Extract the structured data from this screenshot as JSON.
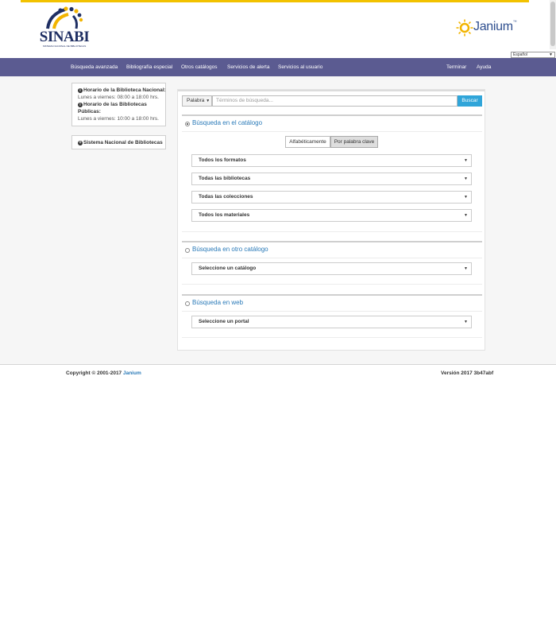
{
  "header": {
    "logo_left": {
      "text": "SINABI",
      "subtitle": "SISTEMA NACIONAL DE BIBLIOTECAS"
    },
    "logo_right": {
      "text": "Janium",
      "tm": "™"
    },
    "language": "Español"
  },
  "nav": {
    "left": [
      "Búsqueda avanzada",
      "Bibliografía especial",
      "Otros catálogos",
      "Servicios de alerta",
      "Servicios al usuario"
    ],
    "right": [
      "Terminar",
      "Ayuda"
    ]
  },
  "sidebar": {
    "hours": {
      "line1": "Horario de la Biblioteca Nacional:",
      "line2": "Lunes a viernes: 08:00 a 18:00 hrs.",
      "line3": "Horario de las Bibliotecas",
      "line4": "Públicas:",
      "line5": "Lunes a viernes: 10:00 a 18:00 hrs."
    },
    "link": "Sistema Nacional de Bibliotecas"
  },
  "search": {
    "type_label": "Palabra",
    "placeholder": "Términos de búsqueda...",
    "button": "Buscar"
  },
  "catalog_section": {
    "title": "Búsqueda en el catálogo",
    "selected": true,
    "toggle": {
      "alpha": "Alfabéticamente",
      "keyword": "Por palabra clave",
      "active": "keyword"
    },
    "filters": [
      "Todos los formatos",
      "Todas las bibliotecas",
      "Todas las colecciones",
      "Todos los materiales"
    ]
  },
  "other_catalog_section": {
    "title": "Búsqueda en otro catálogo",
    "selected": false,
    "select": "Seleccione un catálogo"
  },
  "web_section": {
    "title": "Búsqueda en web",
    "selected": false,
    "select": "Seleccione un portal"
  },
  "footer": {
    "copyright": "Copyright © 2001-2017 ",
    "brand": "Janium",
    "version": "Versión 2017 3b47abf"
  },
  "colors": {
    "navbar": "#5b5b91",
    "accent_link": "#2a7ab8",
    "search_button": "#30a5d9",
    "top_accent": "#f2c200"
  }
}
